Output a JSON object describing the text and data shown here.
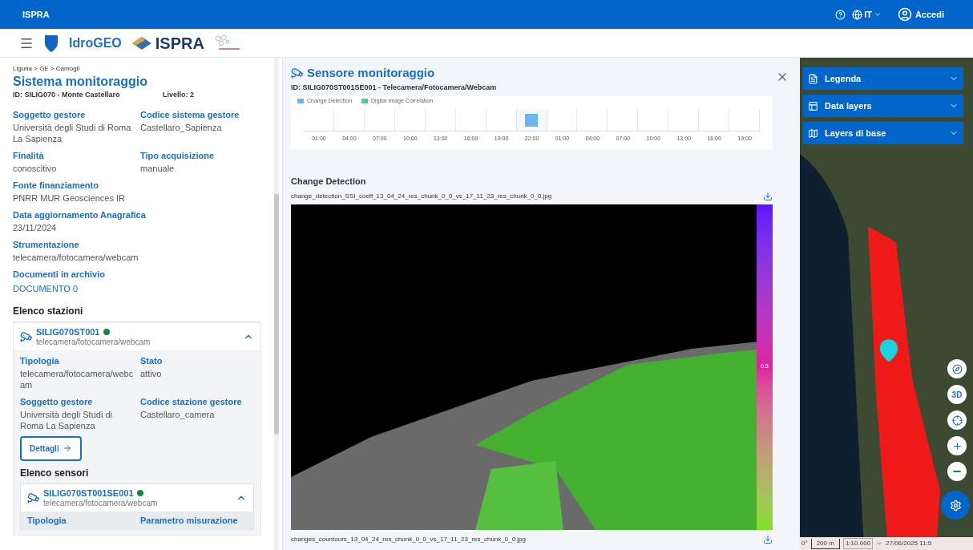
{
  "top_bar": {
    "brand": "ISPRA",
    "language": "IT",
    "login": "Accedi"
  },
  "header": {
    "app_name": "IdroGEO",
    "logo_text": "ISPRA"
  },
  "system": {
    "breadcrumb": "Liguria > GE > Camogli",
    "title": "Sistema monitoraggio",
    "id": "ID: SILIG070 - Monte Castellaro",
    "level_text": "Livello: 2",
    "field_rows": [
      [
        {
          "label": "Soggetto gestore",
          "value": "Università degli Studi di Roma La Sapienza",
          "kind": "text"
        },
        {
          "label": "Codice sistema gestore",
          "value": "Castellaro_Sapienza",
          "kind": "text"
        }
      ],
      [
        {
          "label": "Finalità",
          "value": "conoscitivo",
          "kind": "text"
        },
        {
          "label": "Tipo acquisizione",
          "value": "manuale",
          "kind": "text"
        }
      ],
      [
        {
          "label": "Fonte finanziamento",
          "value": "PNRR MUR Geosciences IR",
          "kind": "text"
        }
      ],
      [
        {
          "label": "Data aggiornamento Anagrafica",
          "value": "23/11/2024",
          "kind": "text"
        }
      ],
      [
        {
          "label": "Strumentazione",
          "value": "telecamera/fotocamera/webcam",
          "kind": "text"
        }
      ],
      [
        {
          "label": "Documenti in archivio",
          "value": "DOCUMENTO 0",
          "kind": "link"
        }
      ]
    ]
  },
  "stations": {
    "heading": "Elenco stazioni",
    "items": [
      {
        "code": "SILIG070ST001",
        "subtitle": "telecamera/fotocamera/webcam",
        "color": "#12883e",
        "expanded": true,
        "field_rows": [
          [
            {
              "label": "Tipologia",
              "value": "telecamera/fotocamera/webc am"
            },
            {
              "label": "Stato",
              "value": "attivo"
            }
          ],
          [
            {
              "label": "Soggetto gestore",
              "value": "Università degli Studi di Roma La Sapienza"
            },
            {
              "label": "Codice stazione gestore",
              "value": "Castellaro_camera"
            }
          ]
        ],
        "button": "Dettagli"
      }
    ]
  },
  "sensors": {
    "heading": "Elenco sensori",
    "items": [
      {
        "code": "SILIG070ST001SE001",
        "subtitle": "telecamera/fotocamera/webcam",
        "color": "#12883e",
        "expanded": true,
        "labels": [
          "Tipologia",
          "Parametro misurazione"
        ]
      }
    ]
  },
  "sensor_panel": {
    "title": "Sensore monitoraggio",
    "id": "ID: SILIG070ST001SE001 - Telecamera/Fotocamera/Webcam",
    "legend": [
      {
        "label": "Change Detection",
        "color": "#6cb4f0"
      },
      {
        "label": "Digital Image Correlation",
        "color": "#4fc99a"
      }
    ],
    "ticks": [
      {
        "label": "01:00",
        "selected": false
      },
      {
        "label": "04:00",
        "selected": false
      },
      {
        "label": "07:00",
        "selected": false
      },
      {
        "label": "10:00",
        "selected": false
      },
      {
        "label": "13:00",
        "selected": false
      },
      {
        "label": "16:00",
        "selected": false
      },
      {
        "label": "19:00",
        "selected": false
      },
      {
        "label": "22:00",
        "selected": true
      },
      {
        "label": "01:00",
        "selected": false
      },
      {
        "label": "04:00",
        "selected": false
      },
      {
        "label": "07:00",
        "selected": false
      },
      {
        "label": "10:00",
        "selected": false
      },
      {
        "label": "13:00",
        "selected": false
      },
      {
        "label": "16:00",
        "selected": false
      },
      {
        "label": "19:00",
        "selected": false
      }
    ],
    "section_title": "Change Detection",
    "file_1": "change_detection_SSI_coeff_13_04_24_res_chunk_0_0_vs_17_11_23_res_chunk_0_0.jpg",
    "colorbar_label": "0.5",
    "file_2": "changes_countours_13_04_24_res_chunk_0_0_vs_17_11_23_res_chunk_0_0.jpg"
  },
  "map": {
    "panels": [
      {
        "label": "Legenda",
        "kind": "legend"
      },
      {
        "label": "Data layers",
        "kind": "layers"
      },
      {
        "label": "Layers di base",
        "kind": "base"
      }
    ],
    "controls": [
      {
        "kind": "compass"
      },
      {
        "kind": "text",
        "label": "3D"
      },
      {
        "kind": "locate"
      },
      {
        "kind": "zoom_in"
      },
      {
        "kind": "zoom_out"
      }
    ],
    "status": {
      "heading": "0°",
      "scale": "200 m",
      "ratio": "1:10.000",
      "datetime": "27/06/2025 11:5"
    }
  }
}
